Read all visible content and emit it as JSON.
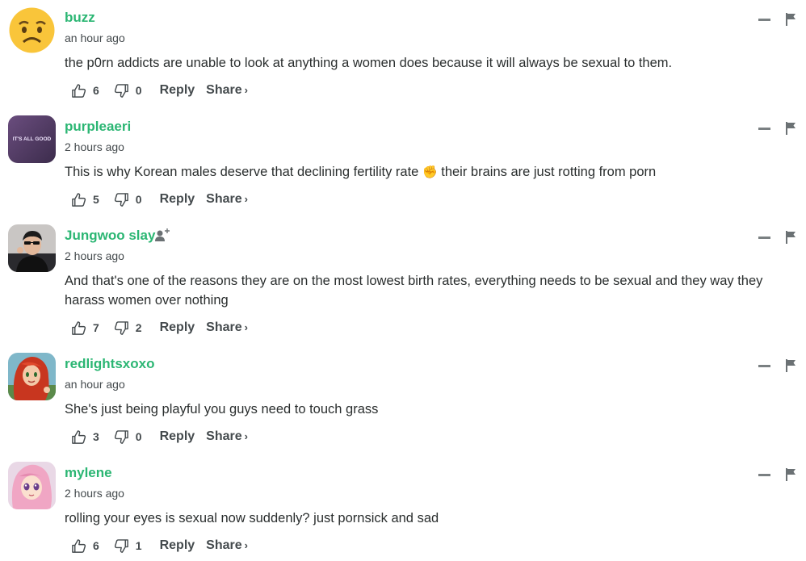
{
  "comments": [
    {
      "username": "buzz",
      "time": "an hour ago",
      "text": "the p0rn addicts are unable to look at anything a women does because it will always be sexual to them.",
      "upvotes": "6",
      "downvotes": "0",
      "reply_label": "Reply",
      "share_label": "Share",
      "share_chevron": "›",
      "avatar_icon": "confused-emoji-avatar"
    },
    {
      "username": "purpleaeri",
      "time": "2 hours ago",
      "text_before": "This is why Korean males deserve that declining fertility rate",
      "emoji": "✊",
      "text_after": "their brains are just rotting from porn",
      "upvotes": "5",
      "downvotes": "0",
      "reply_label": "Reply",
      "share_label": "Share",
      "share_chevron": "›",
      "avatar_text": "IT'S ALL GOOD"
    },
    {
      "username": "Jungwoo slay",
      "time": "2 hours ago",
      "text": "And that's one of the reasons they are on the most lowest birth rates, everything needs to be sexual and they way they harass women over nothing",
      "upvotes": "7",
      "downvotes": "2",
      "reply_label": "Reply",
      "share_label": "Share",
      "share_chevron": "›",
      "avatar_icon": "person-photo-avatar",
      "follow_icon": "add-user-icon"
    },
    {
      "username": "redlightsxoxo",
      "time": "an hour ago",
      "text": "She's just being playful you guys need to touch grass",
      "upvotes": "3",
      "downvotes": "0",
      "reply_label": "Reply",
      "share_label": "Share",
      "share_chevron": "›",
      "avatar_icon": "red-hair-cartoon-avatar"
    },
    {
      "username": "mylene",
      "time": "2 hours ago",
      "text": "rolling your eyes is sexual now suddenly? just pornsick and sad",
      "upvotes": "6",
      "downvotes": "1",
      "reply_label": "Reply",
      "share_label": "Share",
      "share_chevron": "›",
      "avatar_icon": "pink-hair-anime-avatar"
    }
  ],
  "colors": {
    "username": "#2bb673",
    "text": "#2a2e2e",
    "meta": "#444a4d"
  }
}
